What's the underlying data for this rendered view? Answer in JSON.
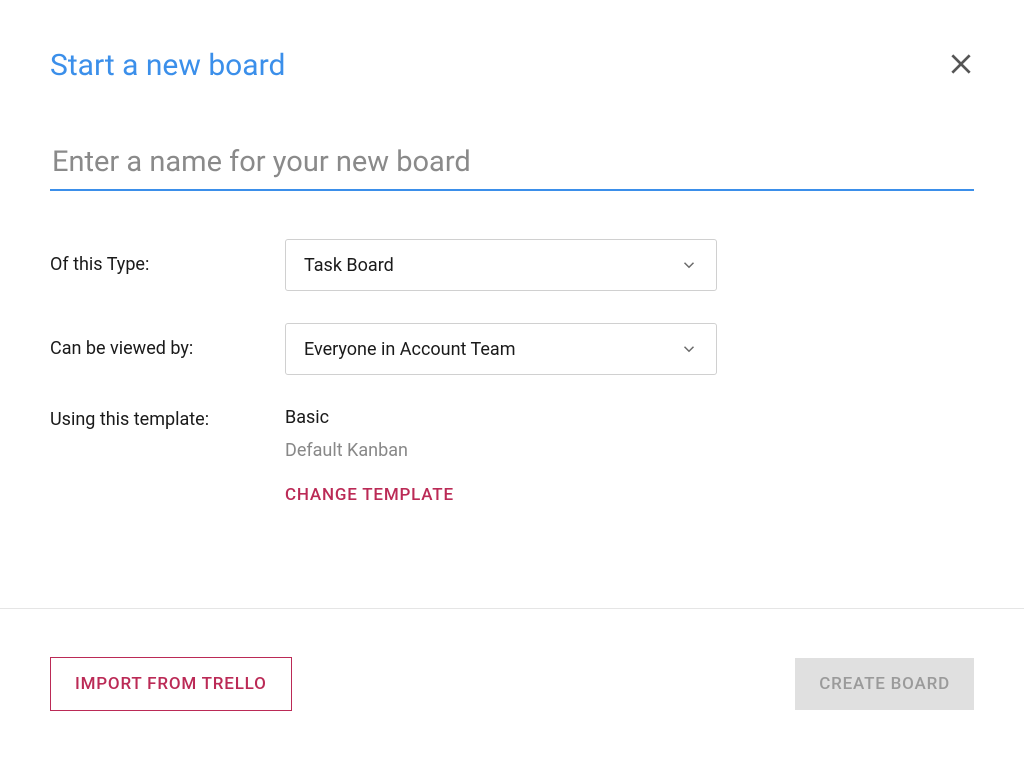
{
  "dialog": {
    "title": "Start a new board",
    "name_placeholder": "Enter a name for your new board",
    "name_value": ""
  },
  "fields": {
    "type_label": "Of this Type:",
    "type_value": "Task Board",
    "visibility_label": "Can be viewed by:",
    "visibility_value": "Everyone in Account Team",
    "template_label": "Using this template:",
    "template_name": "Basic",
    "template_desc": "Default Kanban",
    "change_template": "CHANGE TEMPLATE"
  },
  "footer": {
    "import_label": "IMPORT FROM TRELLO",
    "create_label": "CREATE BOARD"
  }
}
